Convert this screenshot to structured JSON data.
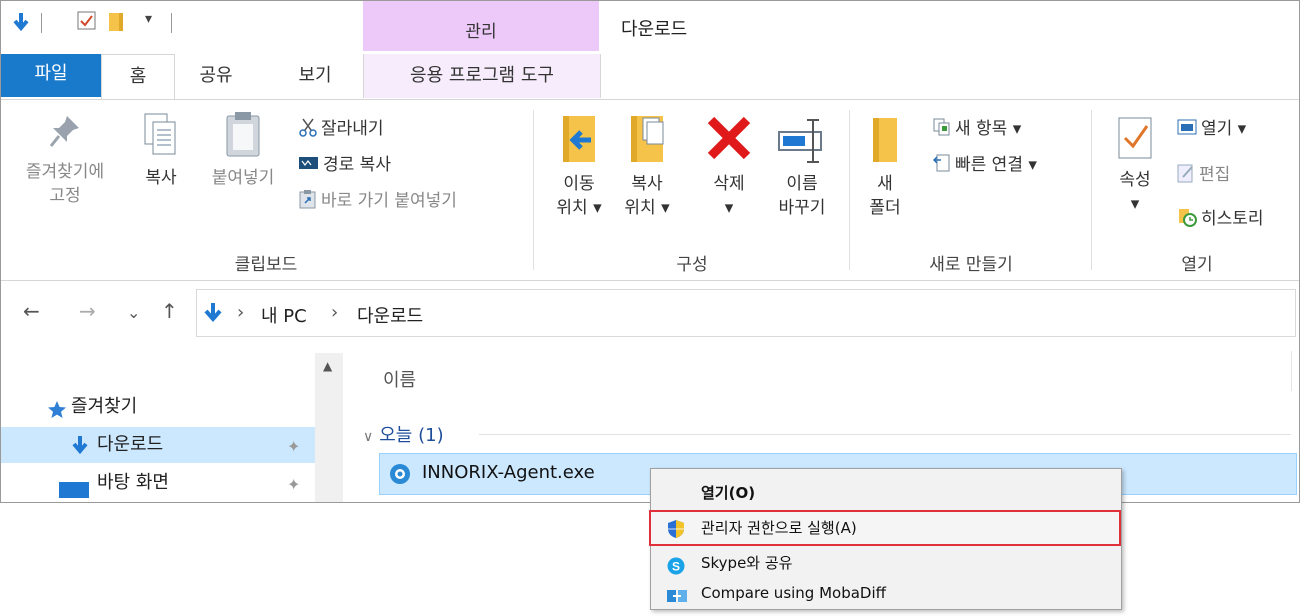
{
  "title_bar": {
    "context_tab_header": "관리",
    "window_title": "다운로드"
  },
  "tabs": {
    "file": "파일",
    "home": "홈",
    "share": "공유",
    "view": "보기",
    "app_tools": "응용 프로그램 도구"
  },
  "ribbon": {
    "clipboard": {
      "pin_line1": "즐겨찾기에",
      "pin_line2": "고정",
      "copy": "복사",
      "paste": "붙여넣기",
      "cut": "잘라내기",
      "copy_path": "경로 복사",
      "paste_shortcut": "바로 가기 붙여넣기",
      "group_label": "클립보드"
    },
    "organize": {
      "move_line1": "이동",
      "move_line2": "위치 ▾",
      "copyto_line1": "복사",
      "copyto_line2": "위치 ▾",
      "delete_line1": "삭제",
      "delete_line2": "▾",
      "rename_line1": "이름",
      "rename_line2": "바꾸기",
      "group_label": "구성"
    },
    "new": {
      "folder_line1": "새",
      "folder_line2": "폴더",
      "new_item": "새 항목 ▾",
      "easy_access": "빠른 연결 ▾",
      "group_label": "새로 만들기"
    },
    "open": {
      "properties_line1": "속성",
      "properties_line2": "▾",
      "open": "열기 ▾",
      "edit": "편집",
      "history": "히스토리",
      "group_label": "열기"
    }
  },
  "address": {
    "back": "←",
    "forward": "→",
    "recent": "⌄",
    "up": "↑",
    "sep1": "›",
    "pc": "내 PC",
    "sep2": "›",
    "folder": "다운로드"
  },
  "nav": {
    "quick_access": "즐겨찾기",
    "downloads": "다운로드",
    "desktop": "바탕 화면"
  },
  "files": {
    "column_name": "이름",
    "group_today": "오늘 (1)",
    "file_name": "INNORIX-Agent.exe"
  },
  "context_menu": {
    "open": "열기(O)",
    "run_as_admin": "관리자 권한으로 실행(A)",
    "skype_share": "Skype와 공유",
    "mobadiff": "Compare using MobaDiff"
  },
  "colors": {
    "file_tab": "#1979ca",
    "context_tab": "#ecc9f8",
    "selection": "#cce8ff",
    "highlight_border": "#e0313a"
  }
}
